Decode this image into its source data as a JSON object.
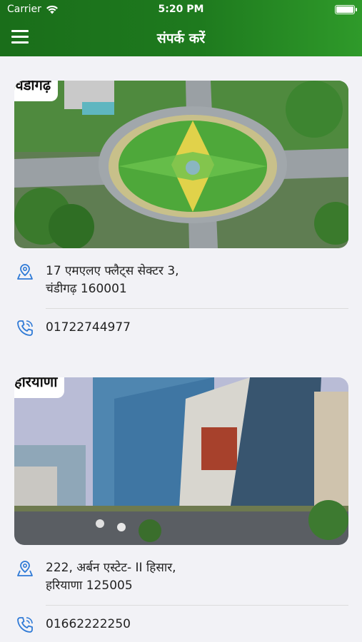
{
  "status": {
    "carrier": "Carrier",
    "time": "5:20 PM"
  },
  "header": {
    "title": "संपर्क करें"
  },
  "offices": [
    {
      "name": "चंडीगढ़",
      "address_line1": "17 एमएलए फ्लैट्स सेक्टर 3,",
      "address_line2": "चंडीगढ़ 160001",
      "phone": "01722744977"
    },
    {
      "name": "हरियाणा",
      "address_line1": "222, अर्बन एस्टेट- II हिसार,",
      "address_line2": "हरियाणा 125005",
      "phone": "01662222250"
    }
  ],
  "colors": {
    "header_green": "#1e7a1e",
    "icon_blue": "#2f7ad6",
    "background": "#f2f2f6"
  },
  "icons": {
    "menu": "hamburger-icon",
    "location": "location-pin-icon",
    "phone": "phone-icon"
  }
}
